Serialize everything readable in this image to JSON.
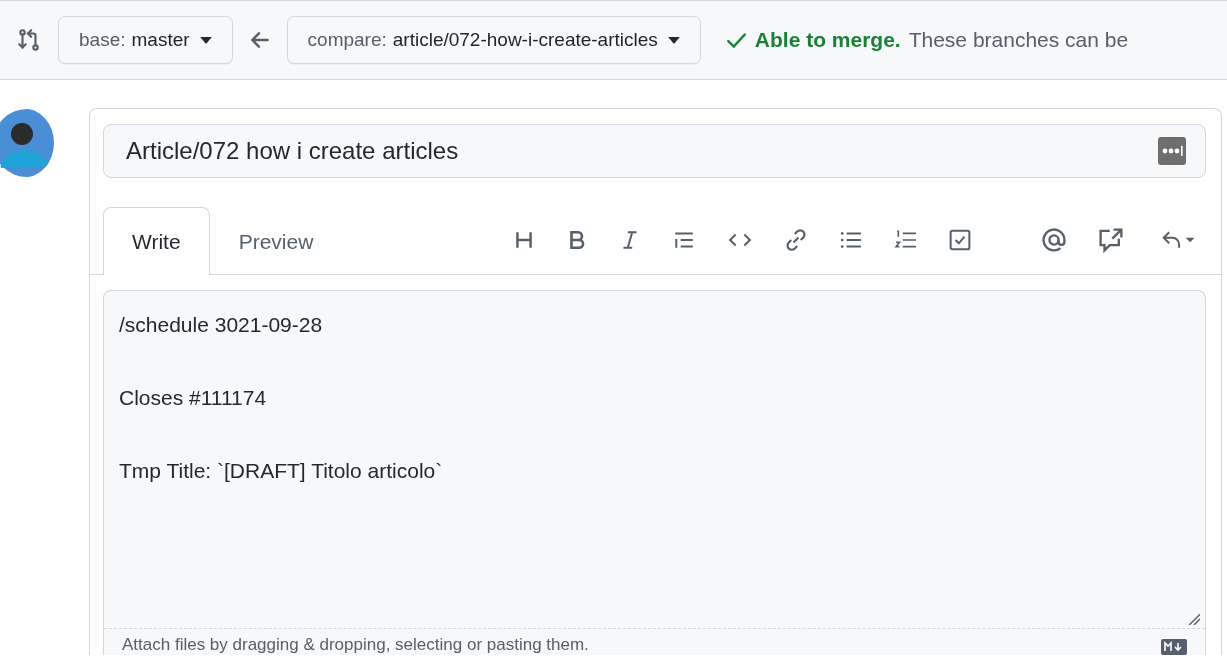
{
  "compare_bar": {
    "base": {
      "label": "base:",
      "branch": "master"
    },
    "compare": {
      "label": "compare:",
      "branch": "article/072-how-i-create-articles"
    },
    "status": {
      "title": "Able to merge.",
      "message": "These branches can be"
    }
  },
  "title_field": {
    "value": "Article/072 how i create articles"
  },
  "tabs": [
    {
      "label": "Write",
      "selected": true
    },
    {
      "label": "Preview",
      "selected": false
    }
  ],
  "body_field": {
    "value": "/schedule 3021-09-28\n\nCloses #111174\n\nTmp Title: `[DRAFT] Titolo articolo`"
  },
  "attach_hint": "Attach files by dragging & dropping, selecting or pasting them."
}
